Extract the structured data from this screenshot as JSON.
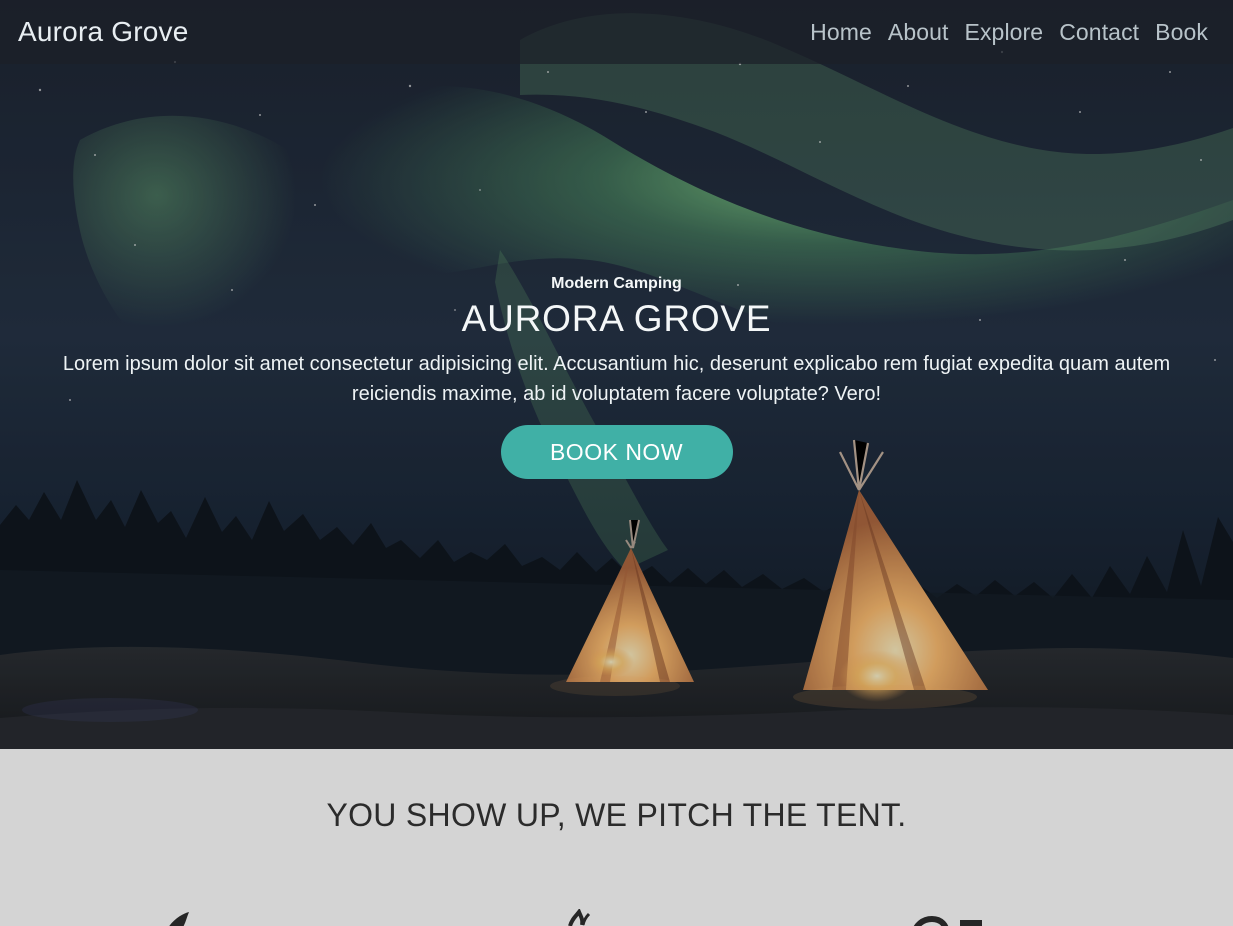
{
  "navbar": {
    "brand": "Aurora Grove",
    "links": [
      "Home",
      "About",
      "Explore",
      "Contact",
      "Book"
    ]
  },
  "hero": {
    "eyebrow": "Modern Camping",
    "title": "AURORA GROVE",
    "text": "Lorem ipsum dolor sit amet consectetur adipisicing elit. Accusantium hic, deserunt explicabo rem fugiat expedita quam autem reiciendis maxime, ab id voluptatem facere voluptate? Vero!",
    "button_label": "BOOK NOW"
  },
  "section": {
    "heading": "YOU SHOW UP, WE PITCH THE TENT.",
    "feature_icons": [
      "feature-icon-1",
      "feature-icon-2",
      "feature-icon-3"
    ]
  },
  "colors": {
    "accent": "#40b0a6",
    "navbar_bg": "#1c2028",
    "section_bg": "#d4d4d4",
    "heading_text": "#2b2b2b"
  }
}
